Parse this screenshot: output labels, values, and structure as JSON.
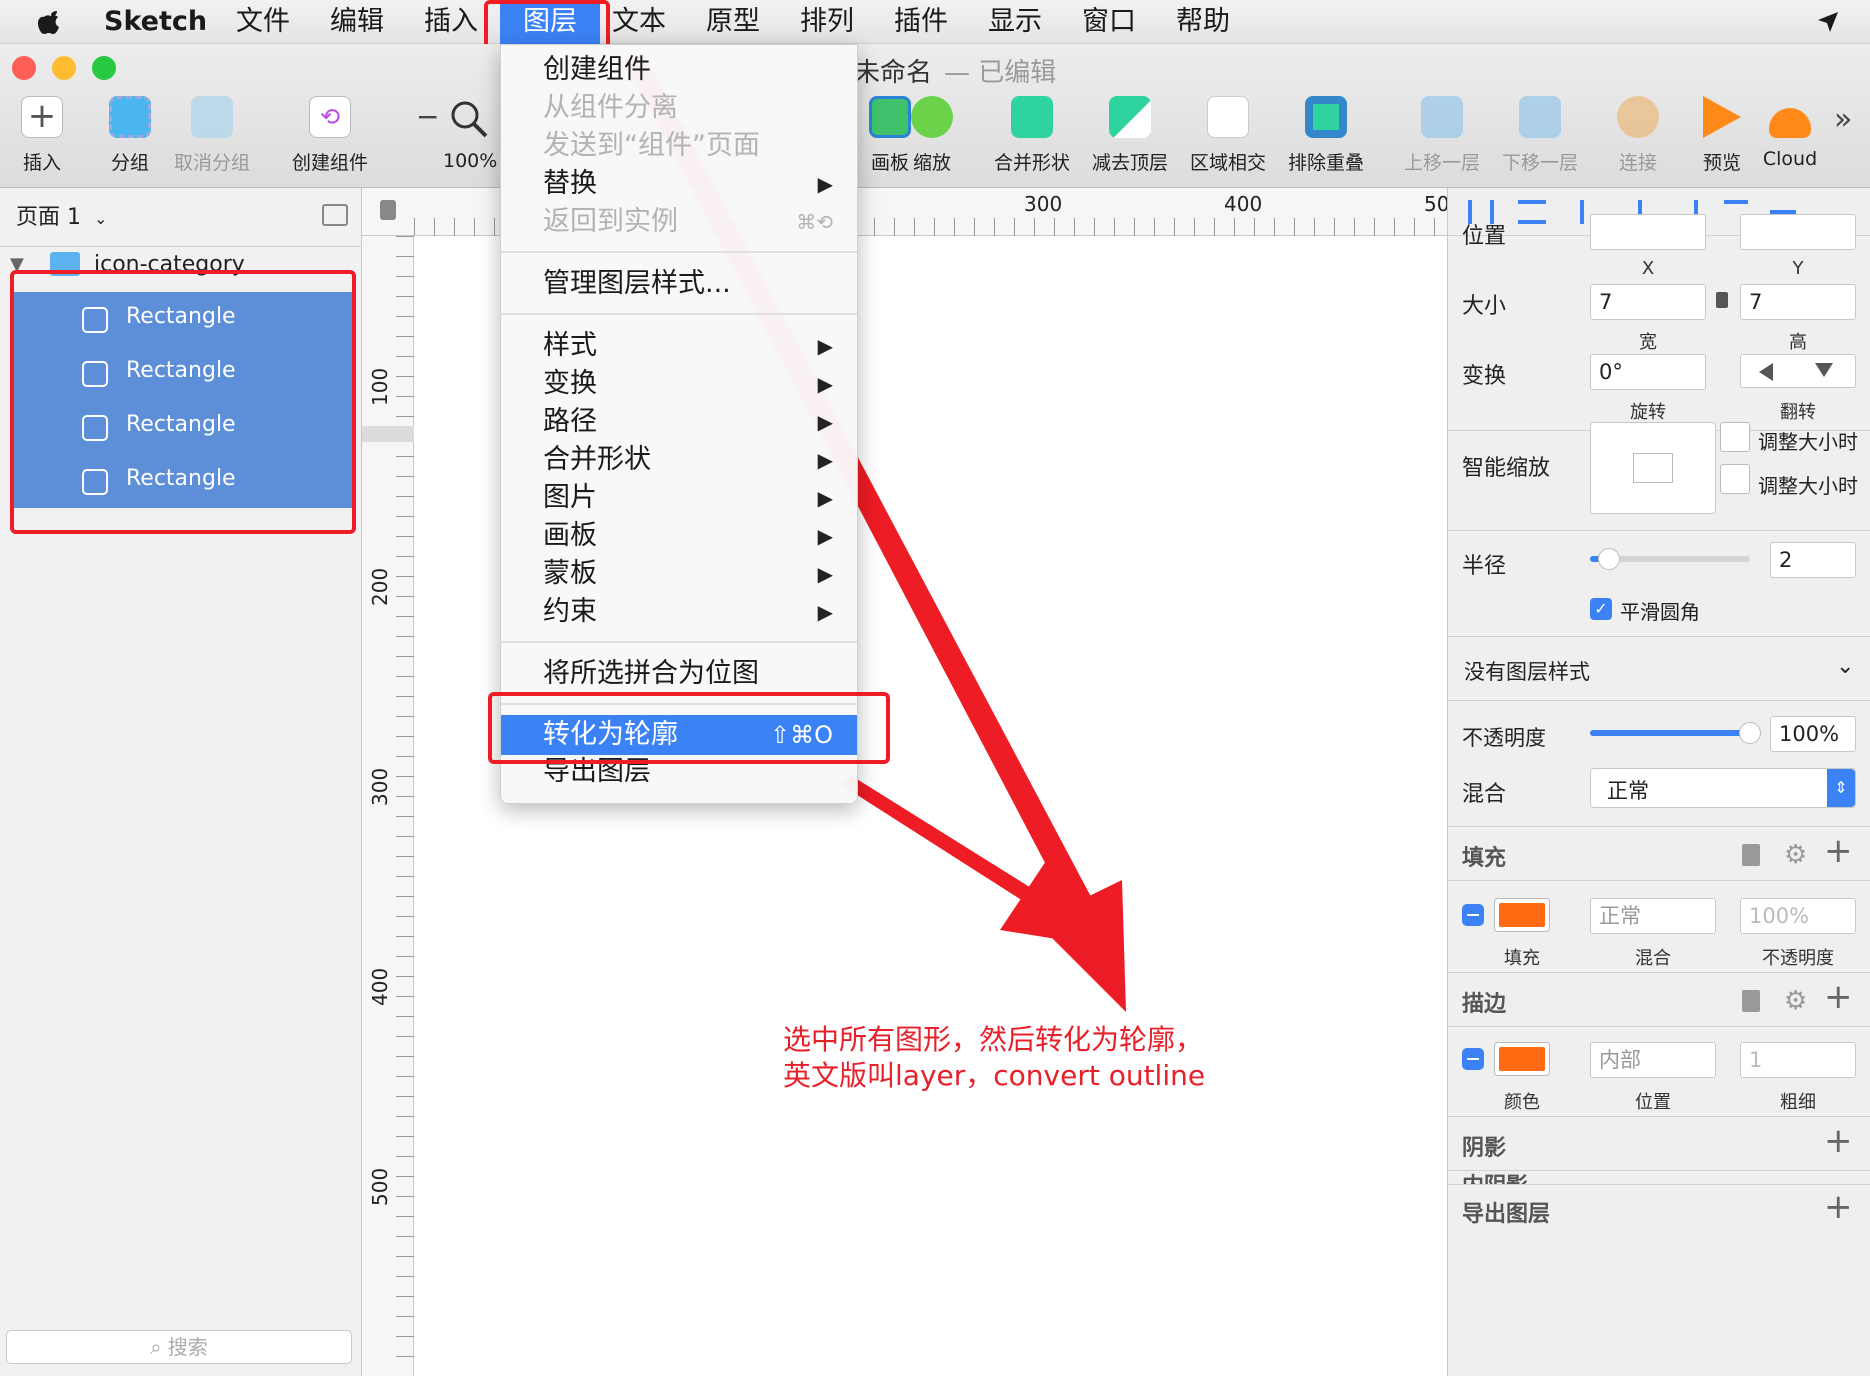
{
  "menubar": {
    "app": "Sketch",
    "items": [
      "文件",
      "编辑",
      "插入",
      "图层",
      "文本",
      "原型",
      "排列",
      "插件",
      "显示",
      "窗口",
      "帮助"
    ]
  },
  "window": {
    "title": "未命名",
    "status": "— 已编辑",
    "lights": [
      "#fd5f57",
      "#febc2e",
      "#28c840"
    ]
  },
  "toolbar": {
    "insert": "插入",
    "group": "分组",
    "ungroup": "取消分组",
    "create_symbol": "创建组件",
    "zoom_minus": "−",
    "zoom": "100%",
    "artboard": "画板",
    "scale": "缩放",
    "union": "合并形状",
    "subtract": "减去顶层",
    "intersect": "区域相交",
    "difference": "排除重叠",
    "forward": "上移一层",
    "backward": "下移一层",
    "link": "连接",
    "preview": "预览",
    "cloud": "Cloud",
    "more": "»"
  },
  "pages": {
    "current": "页面 1"
  },
  "layers": {
    "group": "icon-category",
    "items": [
      "Rectangle",
      "Rectangle",
      "Rectangle",
      "Rectangle"
    ]
  },
  "search": {
    "placeholder": "搜索"
  },
  "rulers": {
    "h": [
      "300",
      "400",
      "50"
    ],
    "v": [
      "100",
      "200",
      "300",
      "400",
      "500"
    ]
  },
  "layer_menu": {
    "items": [
      {
        "label": "创建组件",
        "enabled": true
      },
      {
        "label": "从组件分离",
        "enabled": false
      },
      {
        "label": "发送到“组件”页面",
        "enabled": false
      },
      {
        "label": "替换",
        "enabled": true,
        "submenu": true
      },
      {
        "label": "返回到实例",
        "enabled": false,
        "shortcut": "⌘⟲"
      },
      {
        "label": "管理图层样式...",
        "enabled": true
      },
      {
        "label": "样式",
        "enabled": true,
        "submenu": true
      },
      {
        "label": "变换",
        "enabled": true,
        "submenu": true
      },
      {
        "label": "路径",
        "enabled": true,
        "submenu": true
      },
      {
        "label": "合并形状",
        "enabled": true,
        "submenu": true
      },
      {
        "label": "图片",
        "enabled": true,
        "submenu": true
      },
      {
        "label": "画板",
        "enabled": true,
        "submenu": true
      },
      {
        "label": "蒙板",
        "enabled": true,
        "submenu": true
      },
      {
        "label": "约束",
        "enabled": true,
        "submenu": true
      },
      {
        "label": "将所选拼合为位图",
        "enabled": true
      },
      {
        "label": "转化为轮廓",
        "enabled": true,
        "shortcut": "⇧⌘O",
        "highlighted": true
      },
      {
        "label": "导出图层",
        "enabled": true
      }
    ]
  },
  "inspector": {
    "position": {
      "label": "位置",
      "x": "",
      "y": "",
      "x_label": "X",
      "y_label": "Y"
    },
    "size": {
      "label": "大小",
      "w": "7",
      "h": "7",
      "w_label": "宽",
      "h_label": "高"
    },
    "transform": {
      "label": "变换",
      "rotate": "0°",
      "rotate_label": "旋转",
      "flip_label": "翻转"
    },
    "resizing": {
      "label": "智能缩放",
      "opt1": "调整大小时",
      "opt2": "调整大小时"
    },
    "radius": {
      "label": "半径",
      "value": "2",
      "slider": 0.12,
      "smooth": "平滑圆角"
    },
    "style": {
      "label": "没有图层样式"
    },
    "opacity": {
      "label": "不透明度",
      "value": "100%",
      "slider": 1.0
    },
    "blend": {
      "label": "混合",
      "value": "正常"
    },
    "fill": {
      "label": "填充",
      "color": "#ff6a13",
      "blend": "正常",
      "opacity": "100%",
      "fill_label": "填充",
      "blend_label": "混合",
      "opacity_label": "不透明度"
    },
    "border": {
      "label": "描边",
      "color": "#ff6a13",
      "position": "内部",
      "thickness": "1",
      "color_label": "颜色",
      "position_label": "位置",
      "thickness_label": "粗细"
    },
    "shadow": {
      "label": "阴影"
    },
    "inner_shadow": {
      "label": "内阴影"
    },
    "export": {
      "label": "导出图层"
    }
  },
  "annotation": {
    "line1": "选中所有图形，然后转化为轮廓，",
    "line2": "英文版叫layer，convert outline",
    "color": "#e8202a"
  }
}
